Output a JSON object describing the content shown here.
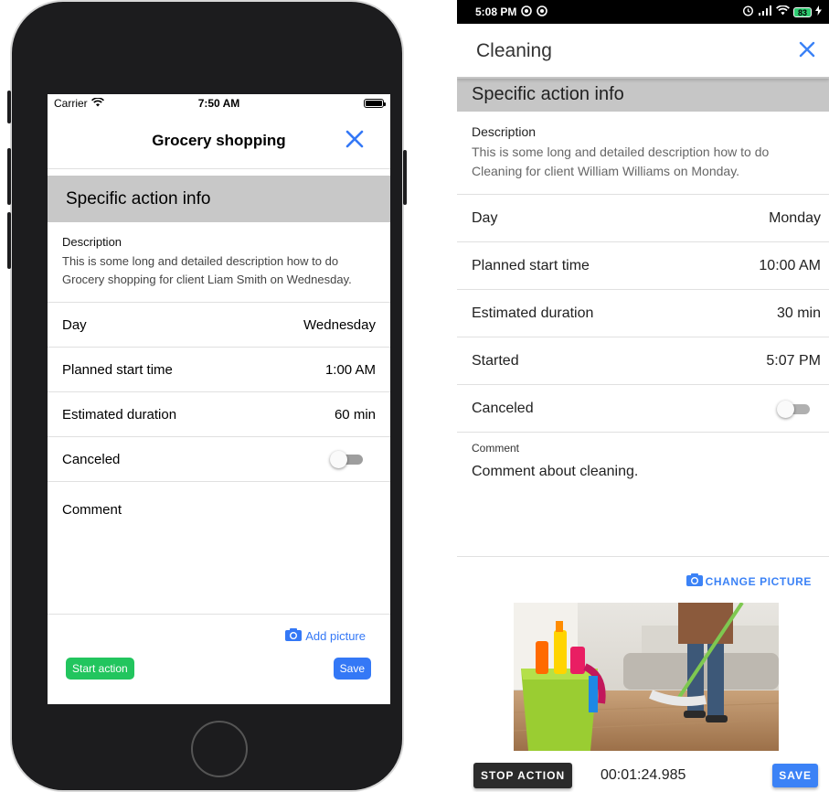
{
  "ios": {
    "status": {
      "carrier": "Carrier",
      "time": "7:50 AM"
    },
    "header": {
      "title": "Grocery shopping"
    },
    "section_title": "Specific action info",
    "description": {
      "label": "Description",
      "text": " This is some long and detailed description how to do Grocery shopping for client Liam Smith on Wednesday."
    },
    "rows": [
      {
        "label": "Day",
        "value": "Wednesday"
      },
      {
        "label": "Planned start time",
        "value": "1:00 AM"
      },
      {
        "label": "Estimated duration",
        "value": "60 min"
      }
    ],
    "canceled": {
      "label": "Canceled",
      "on": false
    },
    "comment_label": "Comment",
    "add_picture": "Add picture",
    "start_action": "Start action",
    "save": "Save",
    "colors": {
      "accent": "#3478f6",
      "start": "#22c55e",
      "section_bg": "#c8c8c8"
    }
  },
  "android": {
    "status": {
      "time": "5:08 PM",
      "battery": "83"
    },
    "header": {
      "title": "Cleaning"
    },
    "section_title": "Specific action info",
    "description": {
      "label": "Description",
      "text": " This is some long and detailed description how to do Cleaning for client William Williams on Monday."
    },
    "rows": [
      {
        "label": "Day",
        "value": "Monday"
      },
      {
        "label": "Planned start time",
        "value": "10:00 AM"
      },
      {
        "label": "Estimated duration",
        "value": "30 min"
      },
      {
        "label": "Started",
        "value": "5:07 PM"
      }
    ],
    "canceled": {
      "label": "Canceled",
      "on": false
    },
    "comment": {
      "label": "Comment",
      "text": "Comment about cleaning."
    },
    "change_picture": "CHANGE PICTURE",
    "stop_action": "STOP ACTION",
    "timer": "00:01:24.985",
    "save": "SAVE",
    "colors": {
      "accent": "#3b82f6",
      "stop": "#2b2b2b",
      "section_bg": "#c6c6c6"
    }
  }
}
